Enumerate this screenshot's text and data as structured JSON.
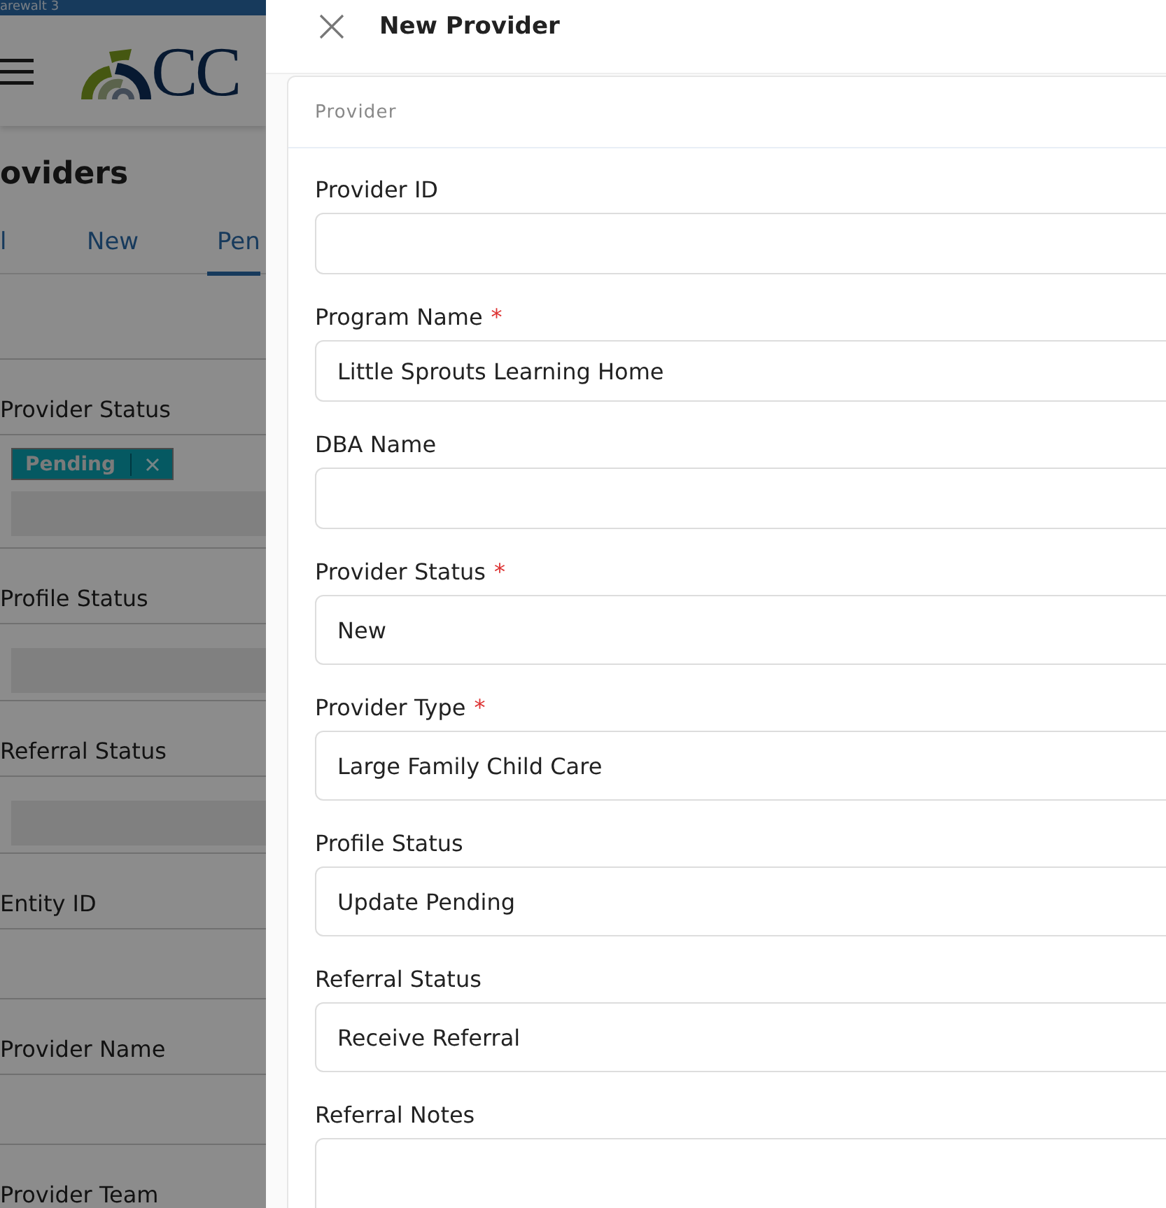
{
  "app_bar": {
    "title": "arewalt 3",
    "logo_text": "CC"
  },
  "page": {
    "title": "oviders",
    "tabs": [
      {
        "label": "l",
        "selected": false
      },
      {
        "label": "New",
        "selected": false
      },
      {
        "label": "Pen",
        "selected": true
      }
    ],
    "filters": [
      {
        "label": "Provider Status",
        "kind": "multiselect",
        "chips": [
          "Pending"
        ]
      },
      {
        "label": "Profile Status",
        "kind": "multiselect"
      },
      {
        "label": "Referral Status",
        "kind": "multiselect"
      },
      {
        "label": "Entity ID",
        "kind": "text"
      },
      {
        "label": "Provider Name",
        "kind": "text"
      },
      {
        "label": "Provider Team",
        "kind": "text"
      }
    ]
  },
  "drawer": {
    "title": "New Provider",
    "section": "Provider",
    "required_marker": "*",
    "fields": [
      {
        "label": "Provider ID",
        "required": false,
        "kind": "text"
      },
      {
        "label": "Program Name",
        "required": true,
        "kind": "text",
        "value": "Little Sprouts Learning Home"
      },
      {
        "label": "DBA Name",
        "required": false,
        "kind": "text"
      },
      {
        "label": "Provider Status",
        "required": true,
        "kind": "select",
        "value": "New"
      },
      {
        "label": "Provider Type",
        "required": true,
        "kind": "select",
        "value": "Large Family Child Care"
      },
      {
        "label": "Profile Status",
        "required": false,
        "kind": "select",
        "value": "Update Pending"
      },
      {
        "label": "Referral Status",
        "required": false,
        "kind": "select",
        "value": "Receive Referral"
      },
      {
        "label": "Referral Notes",
        "required": false,
        "kind": "textarea"
      }
    ]
  }
}
